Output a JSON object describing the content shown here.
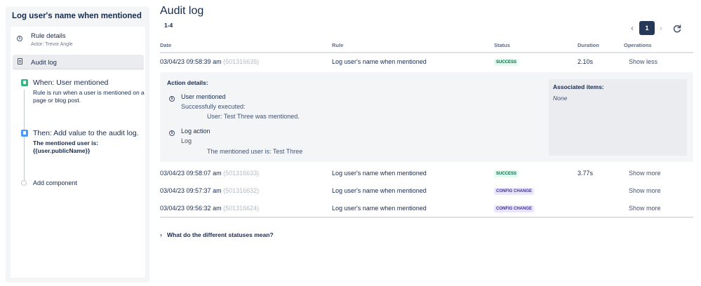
{
  "sidebar": {
    "title": "Log user's name when mentioned",
    "rule_details": {
      "label": "Rule details",
      "actor": "Actor: Trevor Angle"
    },
    "audit_log": {
      "label": "Audit log"
    },
    "trigger": {
      "title": "When: User mentioned",
      "description": "Rule is run when a user is mentioned on a page or blog post."
    },
    "action": {
      "title": "Then: Add value to the audit log.",
      "description": "The mentioned user is: {{user.publicName}}"
    },
    "add_component": "Add component"
  },
  "main": {
    "title": "Audit log",
    "range": "1-4",
    "pagination": {
      "current_page": "1",
      "prev": "‹",
      "next": "›"
    },
    "columns": [
      "Date",
      "Rule",
      "Status",
      "Duration",
      "Operations"
    ],
    "rows": [
      {
        "date": "03/04/23 09:58:39 am",
        "exec_id": "(501316635)",
        "rule": "Log user's name when mentioned",
        "status": "SUCCESS",
        "duration": "2.10s",
        "operation": "Show less"
      },
      {
        "date": "03/04/23 09:58:07 am",
        "exec_id": "(501316633)",
        "rule": "Log user's name when mentioned",
        "status": "SUCCESS",
        "duration": "3.77s",
        "operation": "Show more"
      },
      {
        "date": "03/04/23 09:57:37 am",
        "exec_id": "(501316632)",
        "rule": "Log user's name when mentioned",
        "status": "CONFIG CHANGE",
        "duration": "",
        "operation": "Show more"
      },
      {
        "date": "03/04/23 09:56:32 am",
        "exec_id": "(501316624)",
        "rule": "Log user's name when mentioned",
        "status": "CONFIG CHANGE",
        "duration": "",
        "operation": "Show more"
      }
    ],
    "details": {
      "title": "Action details:",
      "items": [
        {
          "heading": "User mentioned",
          "sub": "Successfully executed:",
          "message": "User: Test Three was mentioned."
        },
        {
          "heading": "Log action",
          "sub": "Log",
          "message": "The mentioned user is: Test Three"
        }
      ],
      "associated_title": "Associated items:",
      "associated_value": "None"
    },
    "faq": "What do the different statuses mean?"
  },
  "colors": {
    "success_bg": "#e3fcef",
    "success_text": "#006644",
    "config_bg": "#eae6ff",
    "config_text": "#403294",
    "pager_active": "#253858"
  }
}
